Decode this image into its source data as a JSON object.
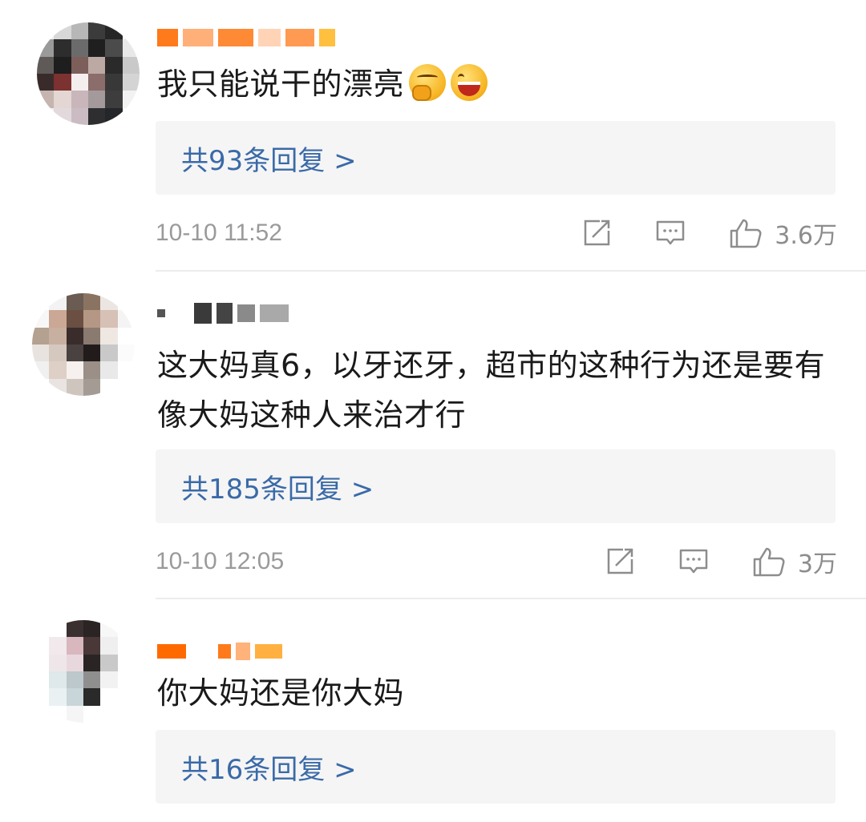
{
  "comments": [
    {
      "text": "我只能说干的漂亮",
      "emojis": [
        "thinking-face",
        "laughing-face"
      ],
      "replies": "共93条回复 >",
      "time": "10-10 11:52",
      "likes": "3.6万"
    },
    {
      "text": "这大妈真6，以牙还牙，超市的这种行为还是要有像大妈这种人来治才行",
      "replies": "共185条回复 >",
      "time": "10-10 12:05",
      "likes": "3万"
    },
    {
      "text": "你大妈还是你大妈",
      "replies": "共16条回复 >"
    }
  ],
  "icons": [
    "share-icon",
    "comment-icon",
    "like-icon"
  ],
  "colors": {
    "link": "#3a6aa8",
    "meta": "#9a9a9a",
    "reply_bg": "#f5f5f5",
    "username_blur": "#ff7a1a"
  }
}
